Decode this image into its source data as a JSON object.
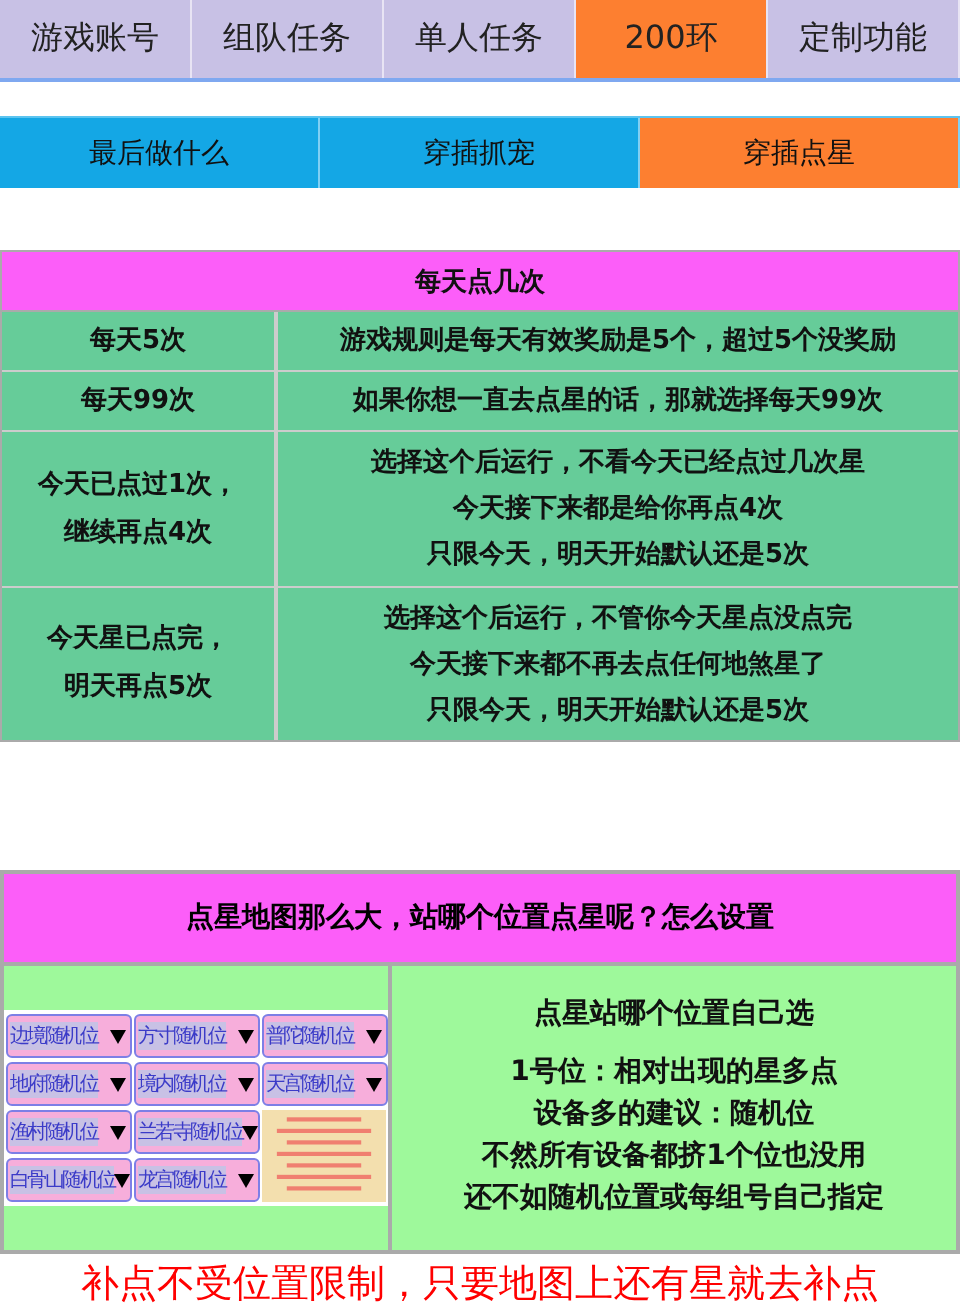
{
  "tabs": [
    {
      "label": "游戏账号",
      "selected": false
    },
    {
      "label": "组队任务",
      "selected": false
    },
    {
      "label": "单人任务",
      "selected": false
    },
    {
      "label": "200环",
      "selected": true
    },
    {
      "label": "定制功能",
      "selected": false
    }
  ],
  "subtabs": [
    {
      "label": "最后做什么",
      "selected": false
    },
    {
      "label": "穿插抓宠",
      "selected": false
    },
    {
      "label": "穿插点星",
      "selected": true
    }
  ],
  "schedule_table": {
    "title": "每天点几次",
    "rows": [
      {
        "option": [
          "每天5次"
        ],
        "description": [
          "游戏规则是每天有效奖励是5个，超过5个没奖励"
        ]
      },
      {
        "option": [
          "每天99次"
        ],
        "description": [
          "如果你想一直去点星的话，那就选择每天99次"
        ]
      },
      {
        "option": [
          "今天已点过1次，",
          "继续再点4次"
        ],
        "description": [
          "选择这个后运行，不看今天已经点过几次星",
          "今天接下来都是给你再点4次",
          "只限今天，明天开始默认还是5次"
        ]
      },
      {
        "option": [
          "今天星已点完，",
          "明天再点5次"
        ],
        "description": [
          "选择这个后运行，不管你今天星点没点完",
          "今天接下来都不再去点任何地煞星了",
          "只限今天，明天开始默认还是5次"
        ]
      }
    ]
  },
  "position_section": {
    "title": "点星地图那么大，站哪个位置点星呢？怎么设置",
    "dropdowns": [
      {
        "label": "边境随机位"
      },
      {
        "label": "方寸随机位"
      },
      {
        "label": "普陀随机位"
      },
      {
        "label": "地府随机位"
      },
      {
        "label": "境内随机位"
      },
      {
        "label": "天宫随机位"
      },
      {
        "label": "渔村随机位"
      },
      {
        "label": "兰若寺随机位"
      },
      {
        "label": "白骨山随机位"
      },
      {
        "label": "龙宫随机位"
      }
    ],
    "heading": "点星站哪个位置自己选",
    "lines": [
      "1号位：相对出现的星多点",
      "设备多的建议：随机位",
      "不然所有设备都挤1个位也没用",
      "还不如随机位置或每组号自己指定"
    ]
  },
  "footer_note": "补点不受位置限制，只要地图上还有星就去补点"
}
